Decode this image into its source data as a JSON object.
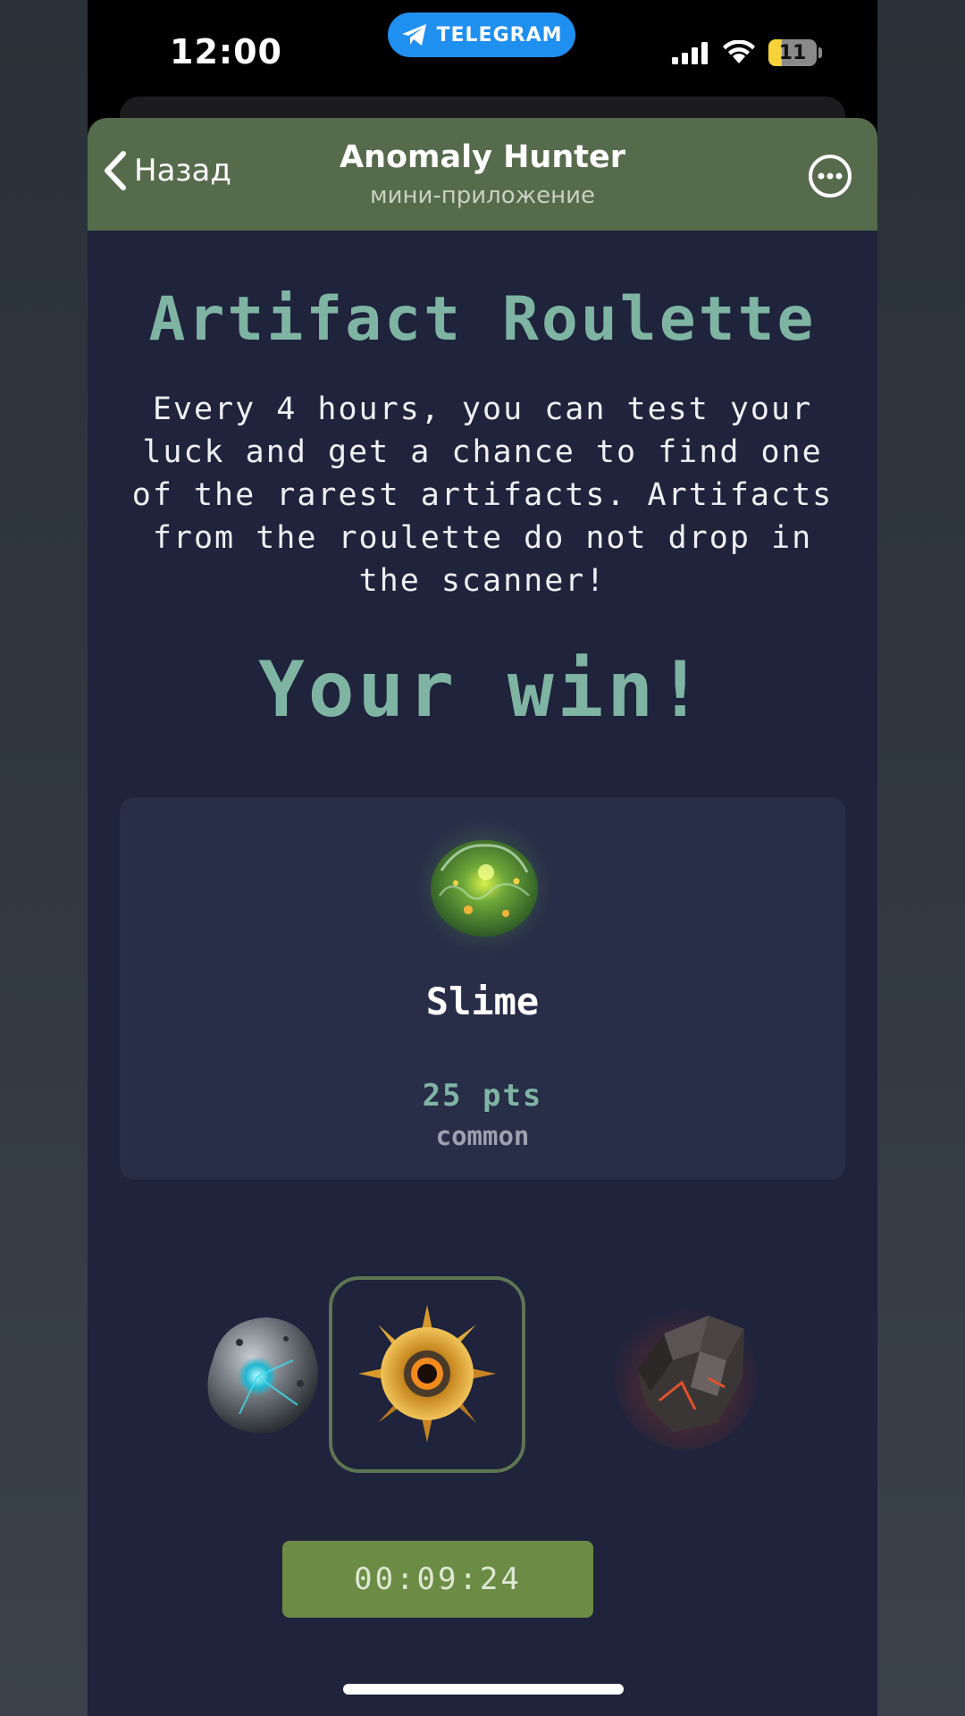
{
  "status_bar": {
    "time": "12:00",
    "app_pill": "TELEGRAM",
    "battery": "11",
    "battery_level_percent": 11
  },
  "header": {
    "back_label": "Назад",
    "title": "Anomaly Hunter",
    "subtitle": "мини-приложение"
  },
  "main": {
    "title": "Artifact Roulette",
    "description": "Every 4 hours, you can test your luck and get a chance to find one of the rarest artifacts. Artifacts from the roulette do not drop in the scanner!",
    "win_heading": "Your win!"
  },
  "prize": {
    "icon": "slime-artifact-icon",
    "name": "Slime",
    "points": "25 pts",
    "rarity": "common"
  },
  "roulette": {
    "items": [
      {
        "icon": "metal-sphere-artifact-icon"
      },
      {
        "icon": "sunflower-artifact-icon",
        "selected": true
      },
      {
        "icon": "lava-rock-artifact-icon"
      }
    ]
  },
  "timer": {
    "value": "00:09:24"
  },
  "colors": {
    "header_bg": "#566b4b",
    "content_bg": "#1f233b",
    "accent_teal": "#7fb4a3",
    "timer_bg": "#6c8c46",
    "telegram_blue": "#1f8ff0"
  }
}
